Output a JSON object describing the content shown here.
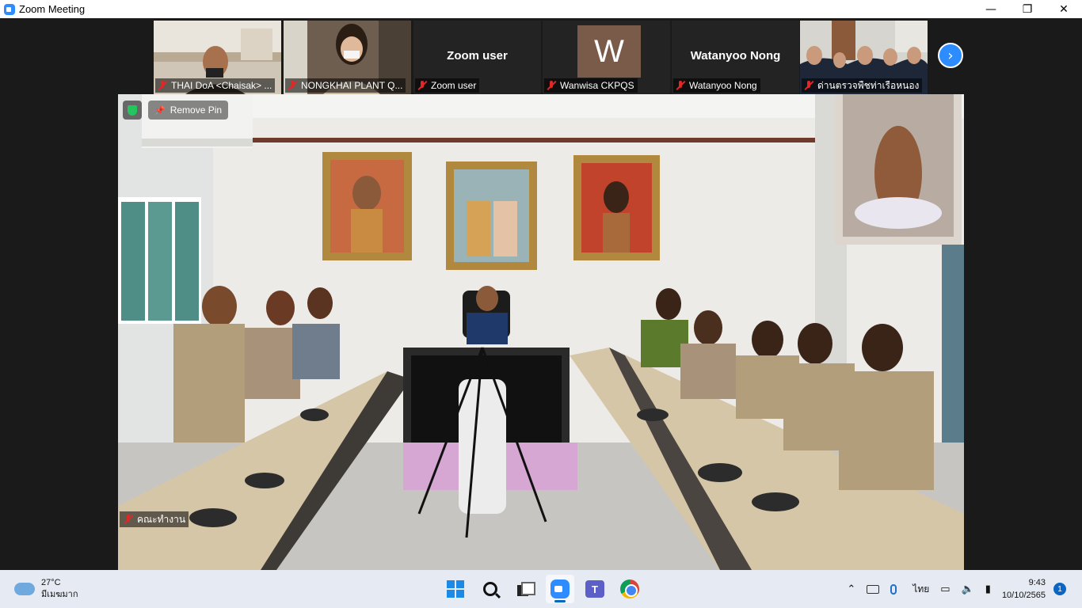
{
  "window": {
    "title": "Zoom Meeting",
    "minimize": "—",
    "maximize": "❐",
    "close": "✕"
  },
  "participants": [
    {
      "name": "THAI DoA <Chaisak> ..."
    },
    {
      "name": "NONGKHAI PLANT Q..."
    },
    {
      "name": "Zoom user",
      "display": "Zoom user"
    },
    {
      "name": "Wanwisa CKPQS",
      "avatar_letter": "W"
    },
    {
      "name": "Watanyoo Nong",
      "display": "Watanyoo Nong"
    },
    {
      "name": "ด่านตรวจพืชท่าเรือหนอง"
    }
  ],
  "next_arrow": "›",
  "main": {
    "remove_pin": "Remove Pin",
    "speaker_name": "คณะทำงาน"
  },
  "taskbar": {
    "weather_temp": "27°C",
    "weather_desc": "มีเมฆมาก",
    "teams_letter": "T",
    "language": "ไทย",
    "time": "9:43",
    "date": "10/10/2565",
    "notification_count": "1"
  }
}
